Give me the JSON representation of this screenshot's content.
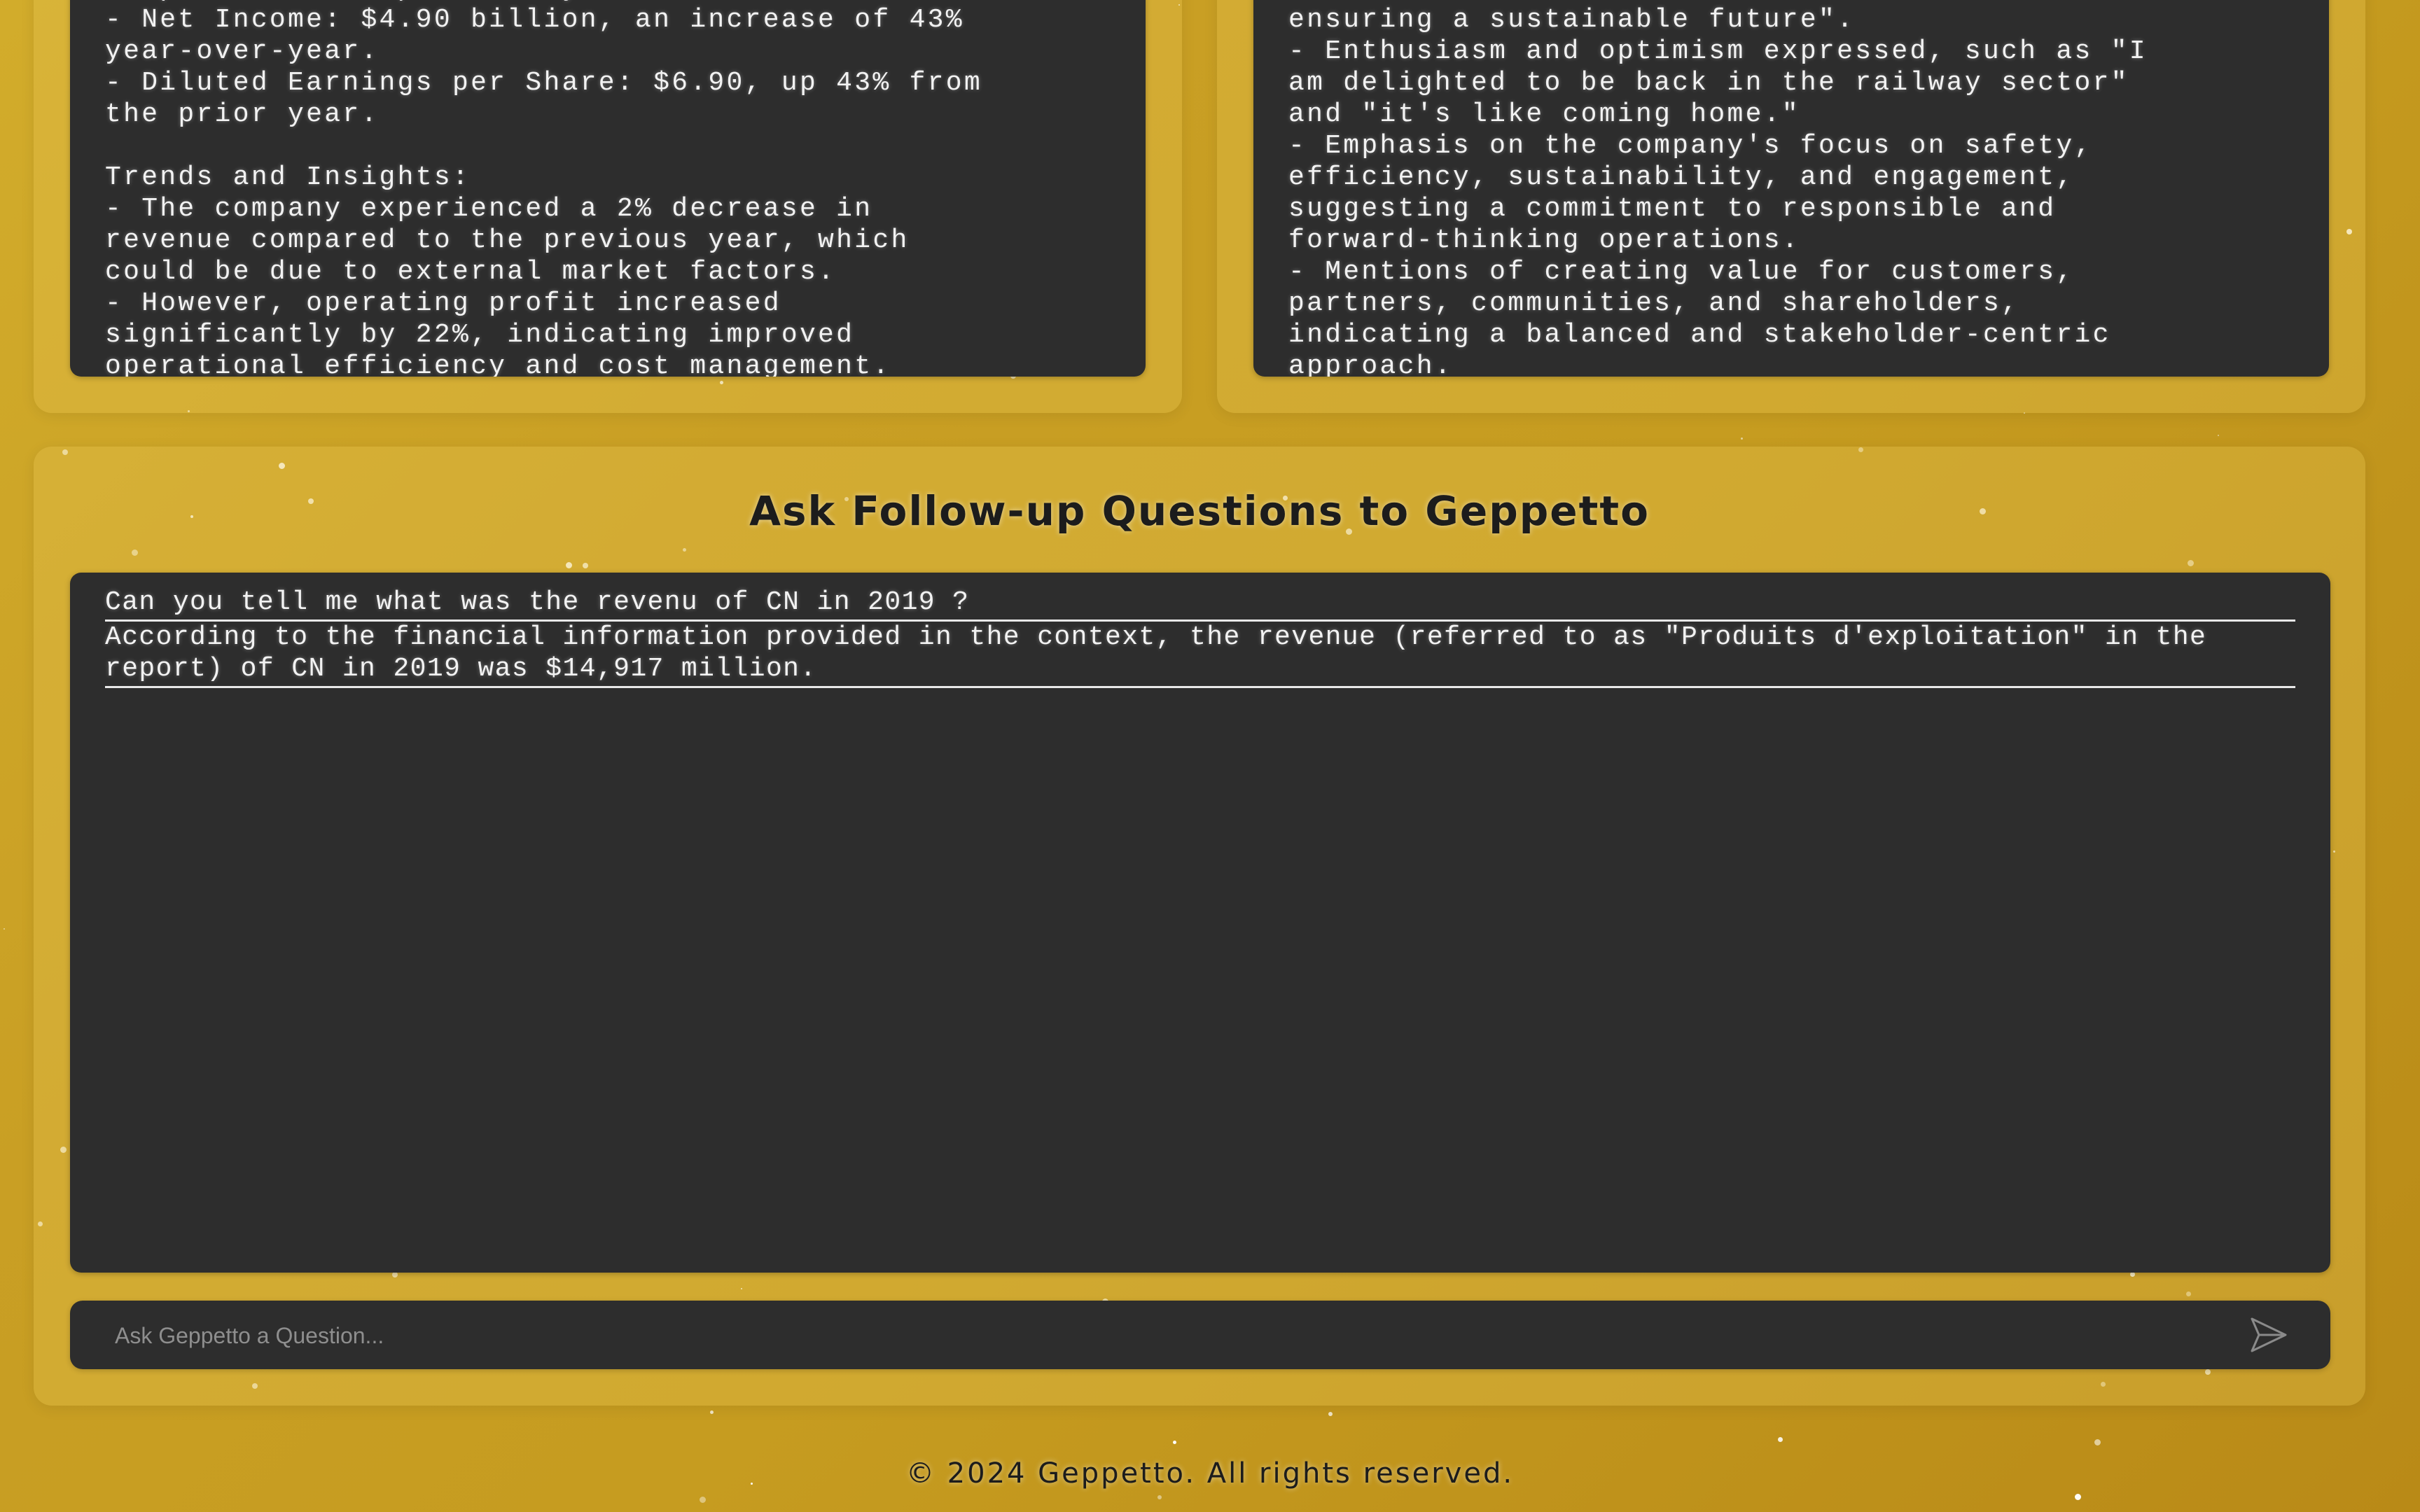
{
  "financial_summary": {
    "text": "compared to the previous year.\n- Net Income: $4.90 billion, an increase of 43%\nyear-over-year.\n- Diluted Earnings per Share: $6.90, up 43% from\nthe prior year.\n\nTrends and Insights:\n- The company experienced a 2% decrease in\nrevenue compared to the previous year, which\ncould be due to external market factors.\n- However, operating profit increased\nsignificantly by 22%, indicating improved\noperational efficiency and cost management."
  },
  "sentiment_summary": {
    "text": "ensuring a sustainable future\".\n- Enthusiasm and optimism expressed, such as \"I\nam delighted to be back in the railway sector\"\nand \"it's like coming home.\"\n- Emphasis on the company's focus on safety,\nefficiency, sustainability, and engagement,\nsuggesting a commitment to responsible and\nforward-thinking operations.\n- Mentions of creating value for customers,\npartners, communities, and shareholders,\nindicating a balanced and stakeholder-centric\napproach."
  },
  "followup": {
    "title": "Ask Follow-up Questions to Geppetto",
    "messages": [
      {
        "role": "user",
        "text": "Can you tell me what was the revenu of CN in 2019 ?"
      },
      {
        "role": "assistant",
        "text": "According to the financial information provided in the context, the revenue (referred to as \"Produits d'exploitation\" in the report) of CN in 2019 was $14,917 million."
      }
    ],
    "input_placeholder": "Ask Geppetto a Question...",
    "input_value": "",
    "send_icon": "send-icon"
  },
  "footer": {
    "text": "© 2024 Geppetto. All rights reserved."
  },
  "colors": {
    "background": "#c99f24",
    "panel_dark": "#2d2d2d",
    "text_light": "#f2f2f2",
    "heading_dark": "#1c1c1c"
  }
}
